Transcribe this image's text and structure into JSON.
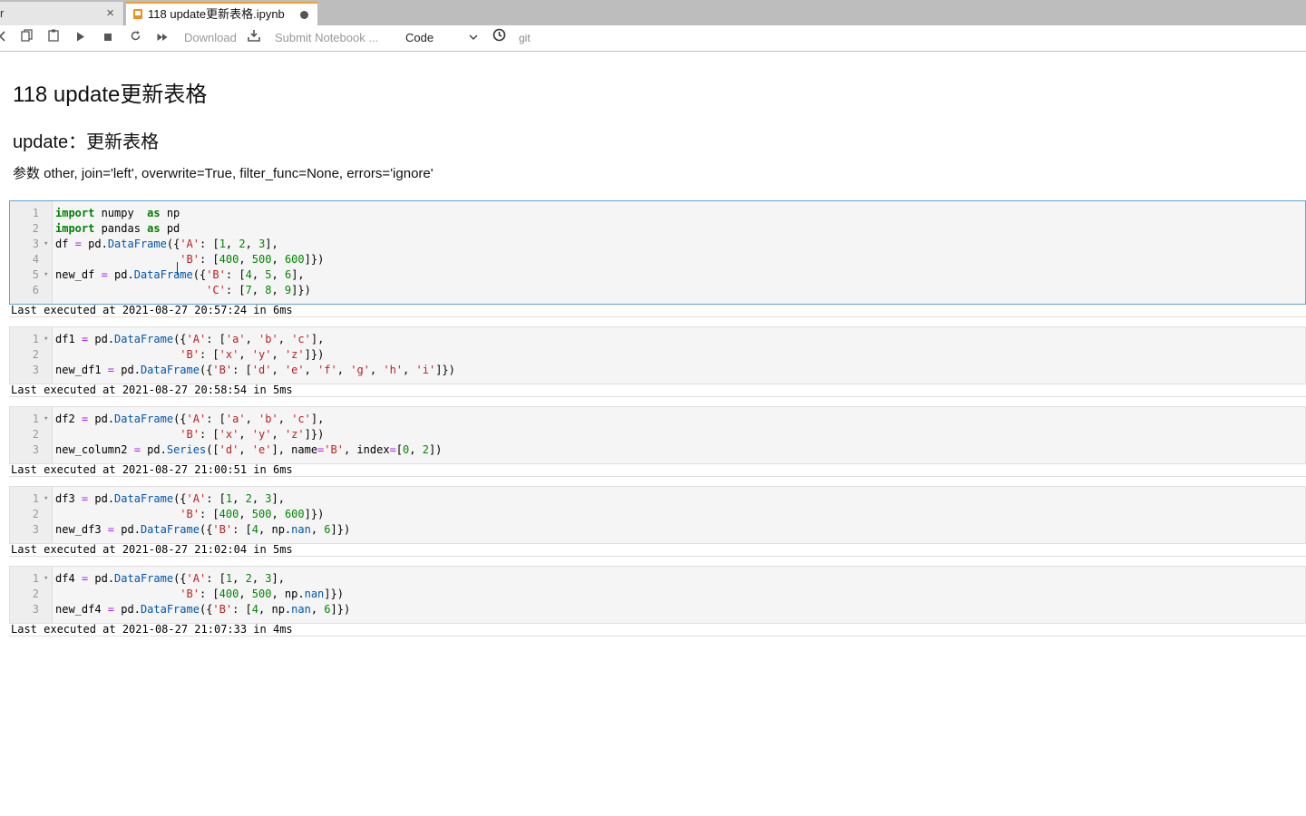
{
  "tabs": [
    {
      "label": "r",
      "close": "×"
    },
    {
      "label": "118 update更新表格.ipynb"
    }
  ],
  "toolbar": {
    "download": "Download",
    "submit": "Submit Notebook ...",
    "cell_type": "Code",
    "git": "git"
  },
  "notebook": {
    "title": "118 update更新表格",
    "subtitle": "update：更新表格",
    "params": "参数 other, join='left', overwrite=True, filter_func=None, errors='ignore'"
  },
  "cells": [
    {
      "status": "Last executed at 2021-08-27 20:57:24 in 6ms",
      "lines": [
        "import numpy  as np",
        "import pandas as pd",
        "df = pd.DataFrame({'A': [1, 2, 3],",
        "                   'B': [400, 500, 600]})",
        "new_df = pd.DataFrame({'B': [4, 5, 6],",
        "                       'C': [7, 8, 9]})"
      ]
    },
    {
      "status": "Last executed at 2021-08-27 20:58:54 in 5ms",
      "lines": [
        "df1 = pd.DataFrame({'A': ['a', 'b', 'c'],",
        "                   'B': ['x', 'y', 'z']})",
        "new_df1 = pd.DataFrame({'B': ['d', 'e', 'f', 'g', 'h', 'i']})"
      ]
    },
    {
      "status": "Last executed at 2021-08-27 21:00:51 in 6ms",
      "lines": [
        "df2 = pd.DataFrame({'A': ['a', 'b', 'c'],",
        "                   'B': ['x', 'y', 'z']})",
        "new_column2 = pd.Series(['d', 'e'], name='B', index=[0, 2])"
      ]
    },
    {
      "status": "Last executed at 2021-08-27 21:02:04 in 5ms",
      "lines": [
        "df3 = pd.DataFrame({'A': [1, 2, 3],",
        "                   'B': [400, 500, 600]})",
        "new_df3 = pd.DataFrame({'B': [4, np.nan, 6]})"
      ]
    },
    {
      "status": "Last executed at 2021-08-27 21:07:33 in 4ms",
      "lines": [
        "df4 = pd.DataFrame({'A': [1, 2, 3],",
        "                   'B': [400, 500, np.nan]})",
        "new_df4 = pd.DataFrame({'B': [4, np.nan, 6]})"
      ]
    }
  ]
}
